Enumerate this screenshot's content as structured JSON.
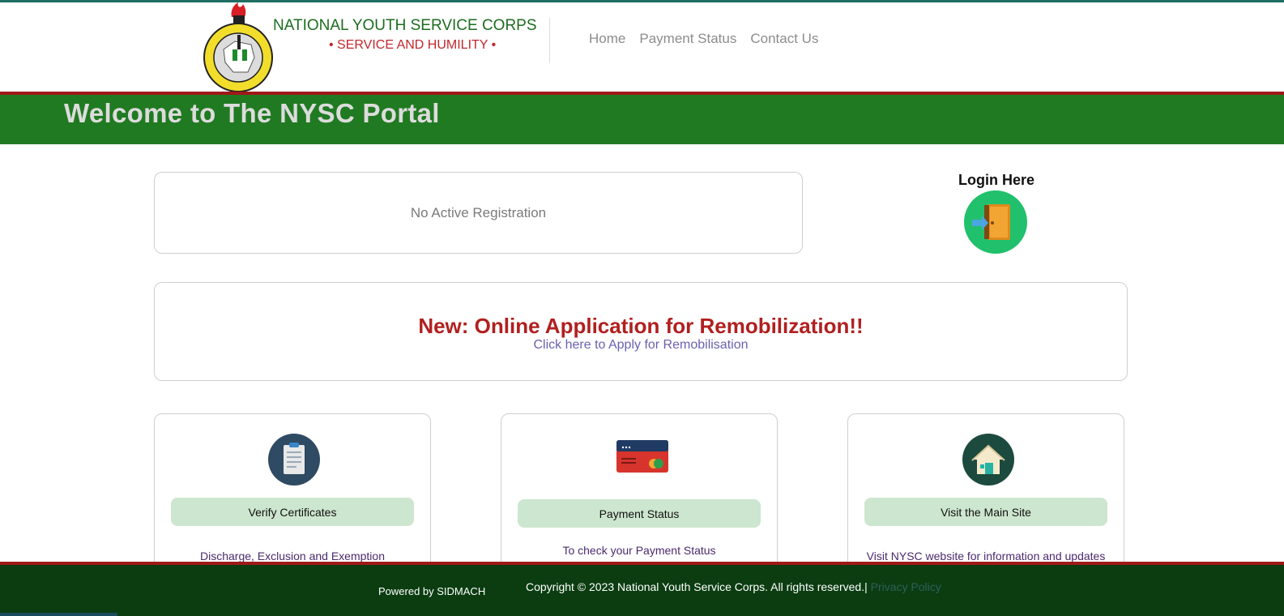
{
  "header": {
    "org_name": "NATIONAL YOUTH SERVICE CORPS",
    "motto": "• SERVICE AND HUMILITY •",
    "logo_icon": "nysc-logo-icon",
    "nav": [
      "Home",
      "Payment Status",
      "Contact Us"
    ]
  },
  "banner": {
    "title": "Welcome to The NYSC Portal"
  },
  "registration": {
    "status_text": "No Active Registration"
  },
  "login": {
    "label": "Login Here",
    "icon": "door-exit-icon"
  },
  "remobilization": {
    "title": "New: Online Application for Remobilization!!",
    "link_text": "Click here to Apply for Remobilisation"
  },
  "features": [
    {
      "icon": "clipboard-icon",
      "button": "Verify Certificates",
      "desc": "Discharge, Exclusion and Exemption"
    },
    {
      "icon": "credit-card-icon",
      "button": "Payment Status",
      "desc": "To check your Payment Status"
    },
    {
      "icon": "house-icon",
      "button": "Visit the Main Site",
      "desc": "Visit NYSC website for information and updates"
    }
  ],
  "footer": {
    "powered_by": "Powered by SIDMACH",
    "copyright": "Copyright © 2023 National Youth Service Corps. All rights reserved.|",
    "privacy": " Privacy Policy"
  },
  "colors": {
    "banner_green": "#207a21",
    "accent_red": "#a01818",
    "footer_green": "#0b3d11",
    "button_green": "#cde6cf"
  }
}
